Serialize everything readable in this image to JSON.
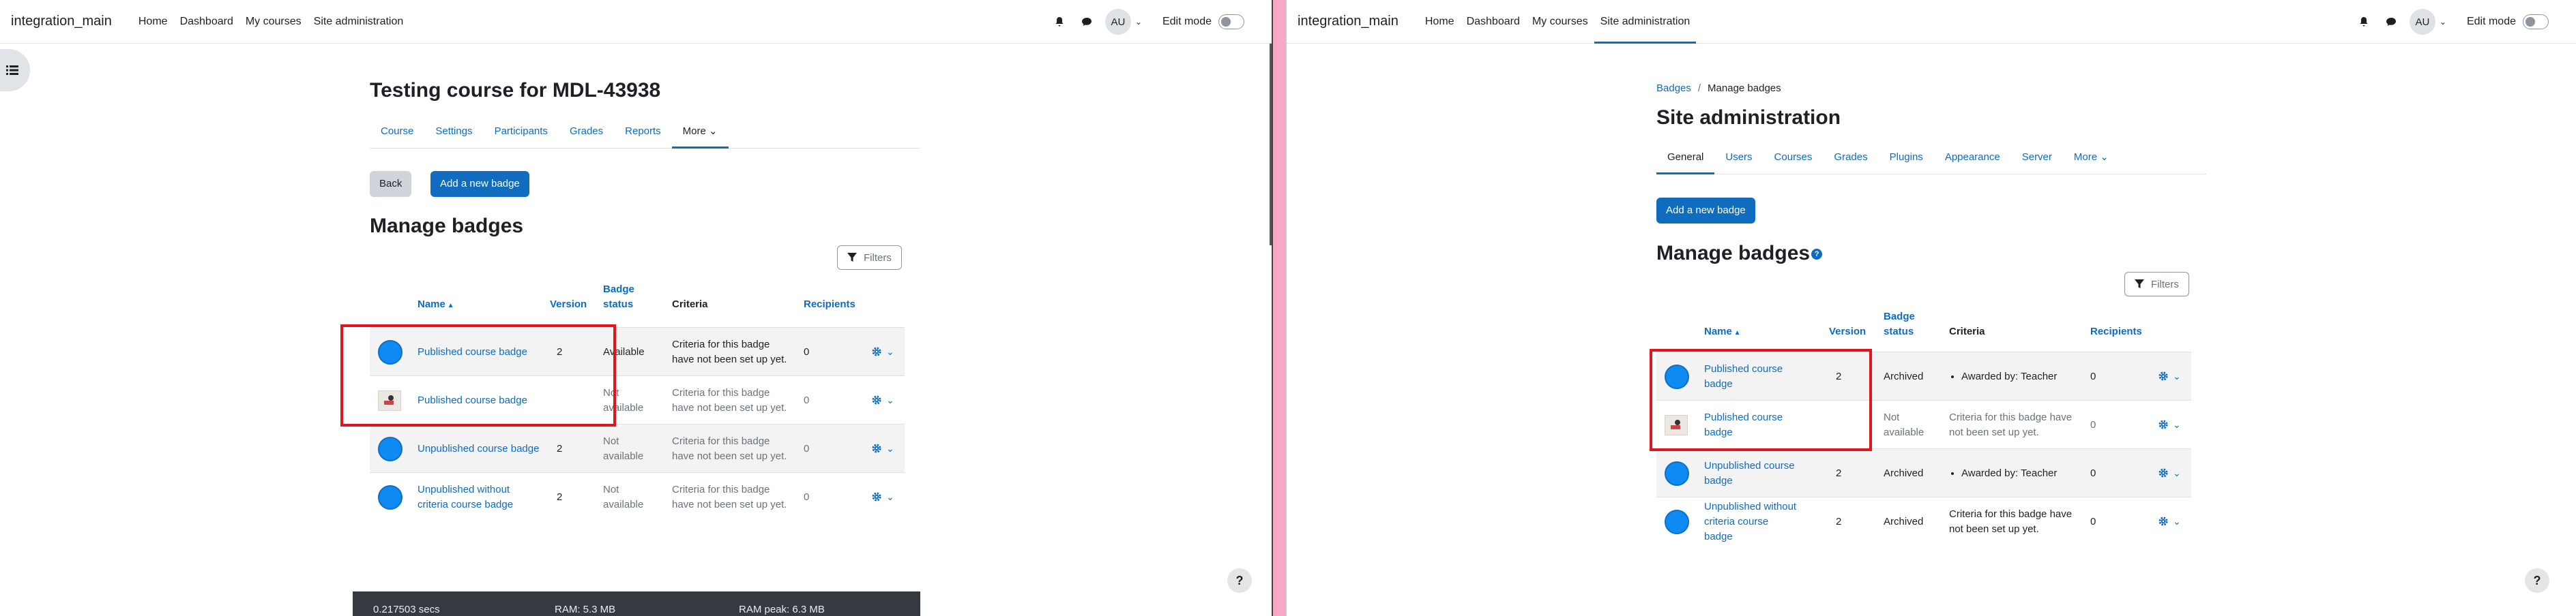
{
  "navbar": {
    "brand": "integration_main",
    "links": [
      "Home",
      "Dashboard",
      "My courses",
      "Site administration"
    ],
    "avatar": "AU",
    "edit_mode": "Edit mode"
  },
  "left": {
    "title": "Testing course for MDL-43938",
    "tabs": [
      "Course",
      "Settings",
      "Participants",
      "Grades",
      "Reports",
      "More"
    ],
    "back_button": "Back",
    "add_button": "Add a new badge",
    "heading": "Manage badges",
    "filters": "Filters",
    "columns": [
      "Name",
      "Version",
      "Badge status",
      "Criteria",
      "Recipients"
    ],
    "rows": [
      {
        "image": "circle",
        "name": "Published course badge",
        "version": "2",
        "status": "Available",
        "criteria": "Criteria for this badge have not been set up yet.",
        "recipients": "0"
      },
      {
        "image": "thumb",
        "name": "Published course badge",
        "version": "",
        "status": "Not available",
        "criteria": "Criteria for this badge have not been set up yet.",
        "recipients": "0"
      },
      {
        "image": "circle",
        "name": "Unpublished course badge",
        "version": "2",
        "status": "Not available",
        "criteria": "Criteria for this badge have not been set up yet.",
        "recipients": "0"
      },
      {
        "image": "circle",
        "name": "Unpublished without criteria course badge",
        "version": "2",
        "status": "Not available",
        "criteria": "Criteria for this badge have not been set up yet.",
        "recipients": "0"
      }
    ],
    "footer": {
      "time": "0.217503 secs",
      "ram": "RAM: 5.3 MB",
      "ram_peak": "RAM peak: 6.3 MB"
    }
  },
  "right": {
    "breadcrumb": [
      "Badges",
      "Manage badges"
    ],
    "title": "Site administration",
    "tabs": [
      "General",
      "Users",
      "Courses",
      "Grades",
      "Plugins",
      "Appearance",
      "Server",
      "More"
    ],
    "add_button": "Add a new badge",
    "heading": "Manage badges",
    "filters": "Filters",
    "columns": [
      "Name",
      "Version",
      "Badge status",
      "Criteria",
      "Recipients"
    ],
    "rows": [
      {
        "image": "circle",
        "name": "Published course badge",
        "version": "2",
        "status": "Archived",
        "criteria": "Awarded by: Teacher",
        "criteria_bullet": true,
        "recipients": "0"
      },
      {
        "image": "thumb",
        "name": "Published course badge",
        "version": "",
        "status": "Not available",
        "criteria": "Criteria for this badge have not been set up yet.",
        "criteria_bullet": false,
        "recipients": "0"
      },
      {
        "image": "circle",
        "name": "Unpublished course badge",
        "version": "2",
        "status": "Archived",
        "criteria": "Awarded by: Teacher",
        "criteria_bullet": true,
        "recipients": "0"
      },
      {
        "image": "circle",
        "name": "Unpublished without criteria course badge",
        "version": "2",
        "status": "Archived",
        "criteria": "Criteria for this badge have not been set up yet.",
        "criteria_bullet": false,
        "recipients": "0"
      }
    ]
  },
  "colors": {
    "primary": "#0f6cbf",
    "highlight": "#e3141d",
    "badge_fill": "#0f8af2"
  }
}
